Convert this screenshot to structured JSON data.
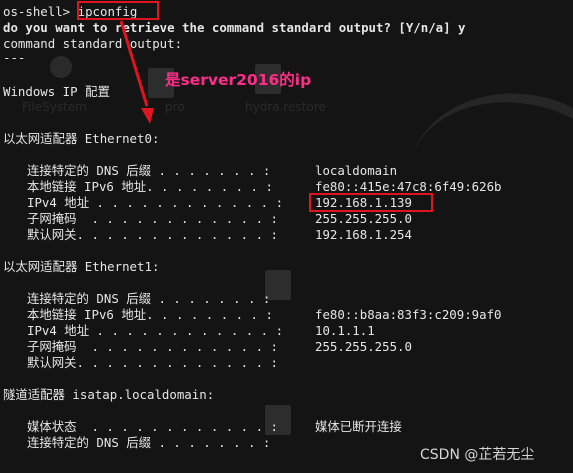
{
  "terminal": {
    "prompt": "os-shell>",
    "command": "ipconfig",
    "question": "do you want to retrieve the command standard output? [Y/n/a] y",
    "output_header": "command standard output:",
    "separator": "---",
    "title": "Windows IP 配置",
    "eth0_header": "以太网适配器 Ethernet0:",
    "eth0": [
      {
        "label": "连接特定的 DNS 后缀 . . . . . . . :",
        "value": "localdomain"
      },
      {
        "label": "本地链接 IPv6 地址. . . . . . . . :",
        "value": "fe80::415e:47c8:6f49:626b"
      },
      {
        "label": "IPv4 地址 . . . . . . . . . . . . :",
        "value": "192.168.1.139"
      },
      {
        "label": "子网掩码  . . . . . . . . . . . . :",
        "value": "255.255.255.0"
      },
      {
        "label": "默认网关. . . . . . . . . . . . . :",
        "value": "192.168.1.254"
      }
    ],
    "eth1_header": "以太网适配器 Ethernet1:",
    "eth1": [
      {
        "label": "连接特定的 DNS 后缀 . . . . . . . :",
        "value": ""
      },
      {
        "label": "本地链接 IPv6 地址. . . . . . . . :",
        "value": "fe80::b8aa:83f3:c209:9af0"
      },
      {
        "label": "IPv4 地址 . . . . . . . . . . . . :",
        "value": "10.1.1.1"
      },
      {
        "label": "子网掩码  . . . . . . . . . . . . :",
        "value": "255.255.255.0"
      },
      {
        "label": "默认网关. . . . . . . . . . . . . :",
        "value": ""
      }
    ],
    "tunnel_header": "隧道适配器 isatap.localdomain:",
    "tunnel": [
      {
        "label": "媒体状态  . . . . . . . . . . . . :",
        "value": "媒体已断开连接"
      },
      {
        "label": "连接特定的 DNS 后缀 . . . . . . . :",
        "value": ""
      }
    ]
  },
  "annotation": {
    "text": "是server2016的ip",
    "color": "#ff2d8a",
    "box_color": "#e0141e"
  },
  "background": {
    "icons": [
      "FileSystem",
      "pro",
      "hydra.restore"
    ]
  },
  "watermark": "CSDN @芷若无尘"
}
